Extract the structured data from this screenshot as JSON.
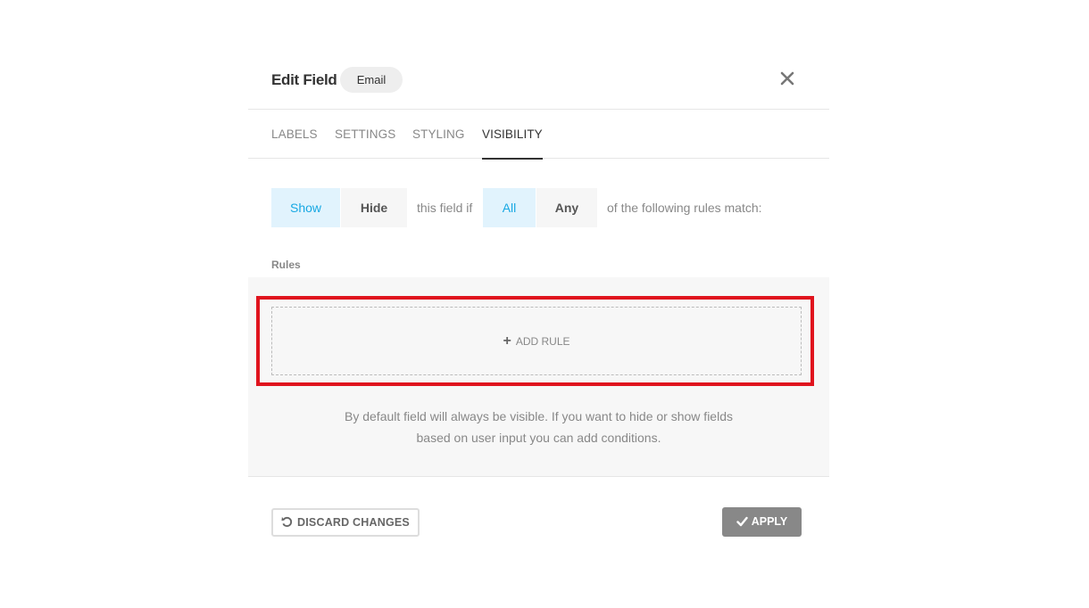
{
  "header": {
    "title": "Edit Field",
    "field_type": "Email",
    "close_icon": "close-icon"
  },
  "tabs": [
    {
      "label": "LABELS",
      "active": false
    },
    {
      "label": "SETTINGS",
      "active": false
    },
    {
      "label": "STYLING",
      "active": false
    },
    {
      "label": "VISIBILITY",
      "active": true
    }
  ],
  "visibility": {
    "show_label": "Show",
    "hide_label": "Hide",
    "middle_text": "this field if",
    "all_label": "All",
    "any_label": "Any",
    "tail_text": "of the following rules match:",
    "selected_action": "Show",
    "selected_match": "All"
  },
  "rules": {
    "label": "Rules",
    "add_rule_label": "ADD RULE",
    "hint_line1": "By default field will always be visible. If you want to hide or show fields",
    "hint_line2": "based on user input you can add conditions."
  },
  "footer": {
    "discard_label": "DISCARD CHANGES",
    "apply_label": "APPLY"
  },
  "colors": {
    "accent": "#17a8e3",
    "accent_bg": "#e1f3fd",
    "highlight": "#e0141e",
    "apply_bg": "#888888"
  }
}
